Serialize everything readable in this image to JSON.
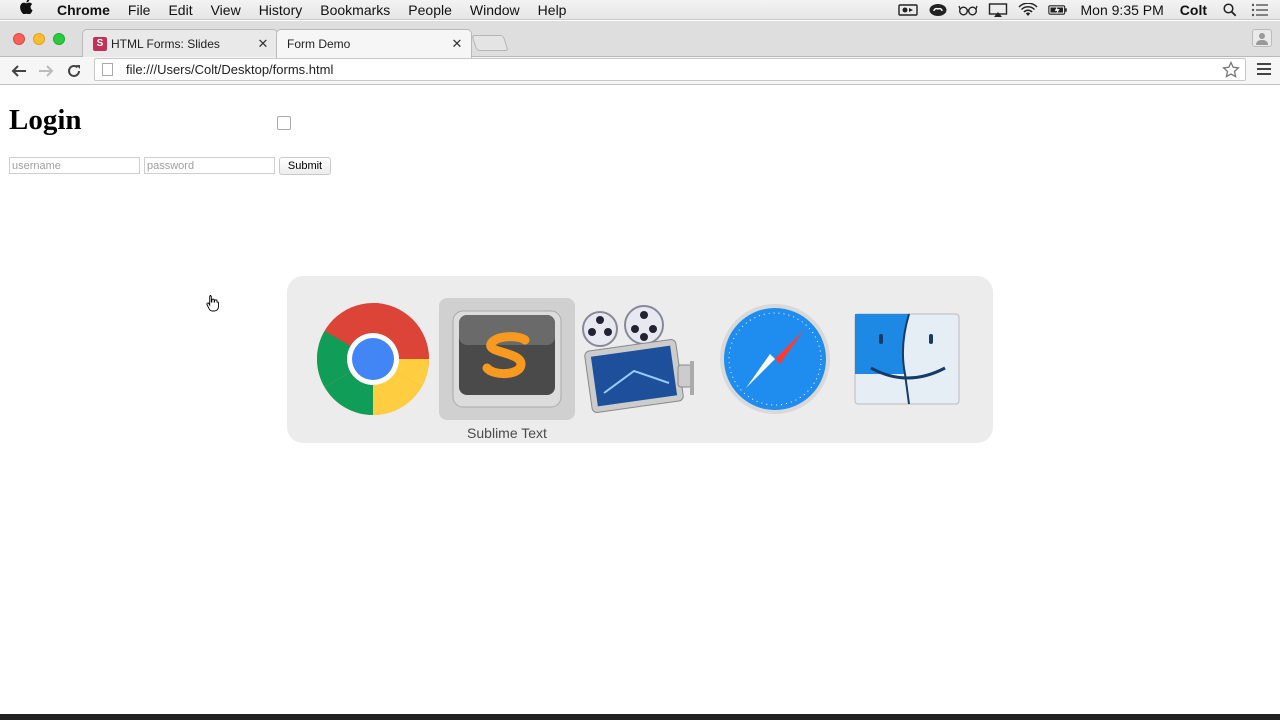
{
  "menubar": {
    "app_name": "Chrome",
    "items": [
      "File",
      "Edit",
      "View",
      "History",
      "Bookmarks",
      "People",
      "Window",
      "Help"
    ],
    "clock": "Mon 9:35 PM",
    "user": "Colt"
  },
  "tabs": [
    {
      "title": "HTML Forms: Slides",
      "favicon": "S"
    },
    {
      "title": "Form Demo"
    }
  ],
  "address": {
    "url": "file:///Users/Colt/Desktop/forms.html"
  },
  "page": {
    "heading": "Login",
    "username_placeholder": "username",
    "password_placeholder": "password",
    "submit_label": "Submit"
  },
  "app_switcher": {
    "apps": [
      "chrome-icon",
      "sublime-text-icon",
      "screenflow-icon",
      "safari-icon",
      "finder-icon"
    ],
    "selected_label": "Sublime Text"
  }
}
